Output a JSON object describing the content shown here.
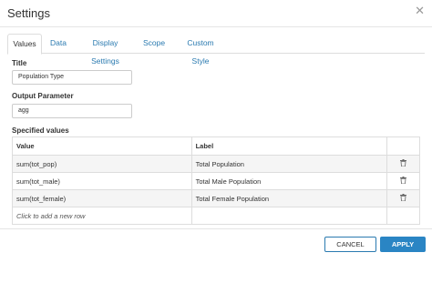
{
  "window": {
    "title": "Settings"
  },
  "tabs": [
    {
      "label": "Values",
      "active": true
    },
    {
      "label": "Data"
    },
    {
      "label": "Display Settings"
    },
    {
      "label": "Scope"
    },
    {
      "label": "Custom Style"
    }
  ],
  "form": {
    "title_label": "Title",
    "title_value": "Population Type",
    "output_label": "Output Parameter",
    "output_value": "agg",
    "specified_label": "Specified values"
  },
  "table": {
    "headers": [
      "Value",
      "Label",
      ""
    ],
    "rows": [
      {
        "value": "sum(tot_pop)",
        "label": "Total Population"
      },
      {
        "value": "sum(tot_male)",
        "label": "Total Male Population"
      },
      {
        "value": "sum(tot_female)",
        "label": "Total Female Population"
      }
    ],
    "add_row_text": "Click to add a new row"
  },
  "footer": {
    "cancel_label": "CANCEL",
    "apply_label": "APPLY"
  },
  "colors": {
    "accent": "#2a85c4",
    "link": "#2a7ab0"
  },
  "icons": {
    "close": "close-icon",
    "delete": "trash-icon"
  }
}
